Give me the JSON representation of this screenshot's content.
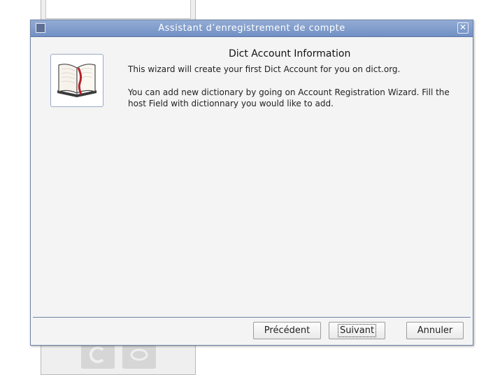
{
  "dialog": {
    "title": "Assistant d’enregistrement de compte",
    "close_label": "✕",
    "heading": "Dict Account Information",
    "intro": "This wizard will create your first Dict Account for you on dict.org.",
    "details": "You can add new dictionary by going on Account Registration Wizard. Fill the host Field with dictionnary you would like to add."
  },
  "buttons": {
    "previous_label": "Précédent",
    "next_label": "Suivant",
    "cancel_label": "Annuler"
  },
  "icons": {
    "window": "app-icon",
    "book": "book-icon"
  },
  "colors": {
    "titlebar": "#7f9ccb",
    "border": "#6f84a8",
    "bookmark": "#b4232a"
  }
}
